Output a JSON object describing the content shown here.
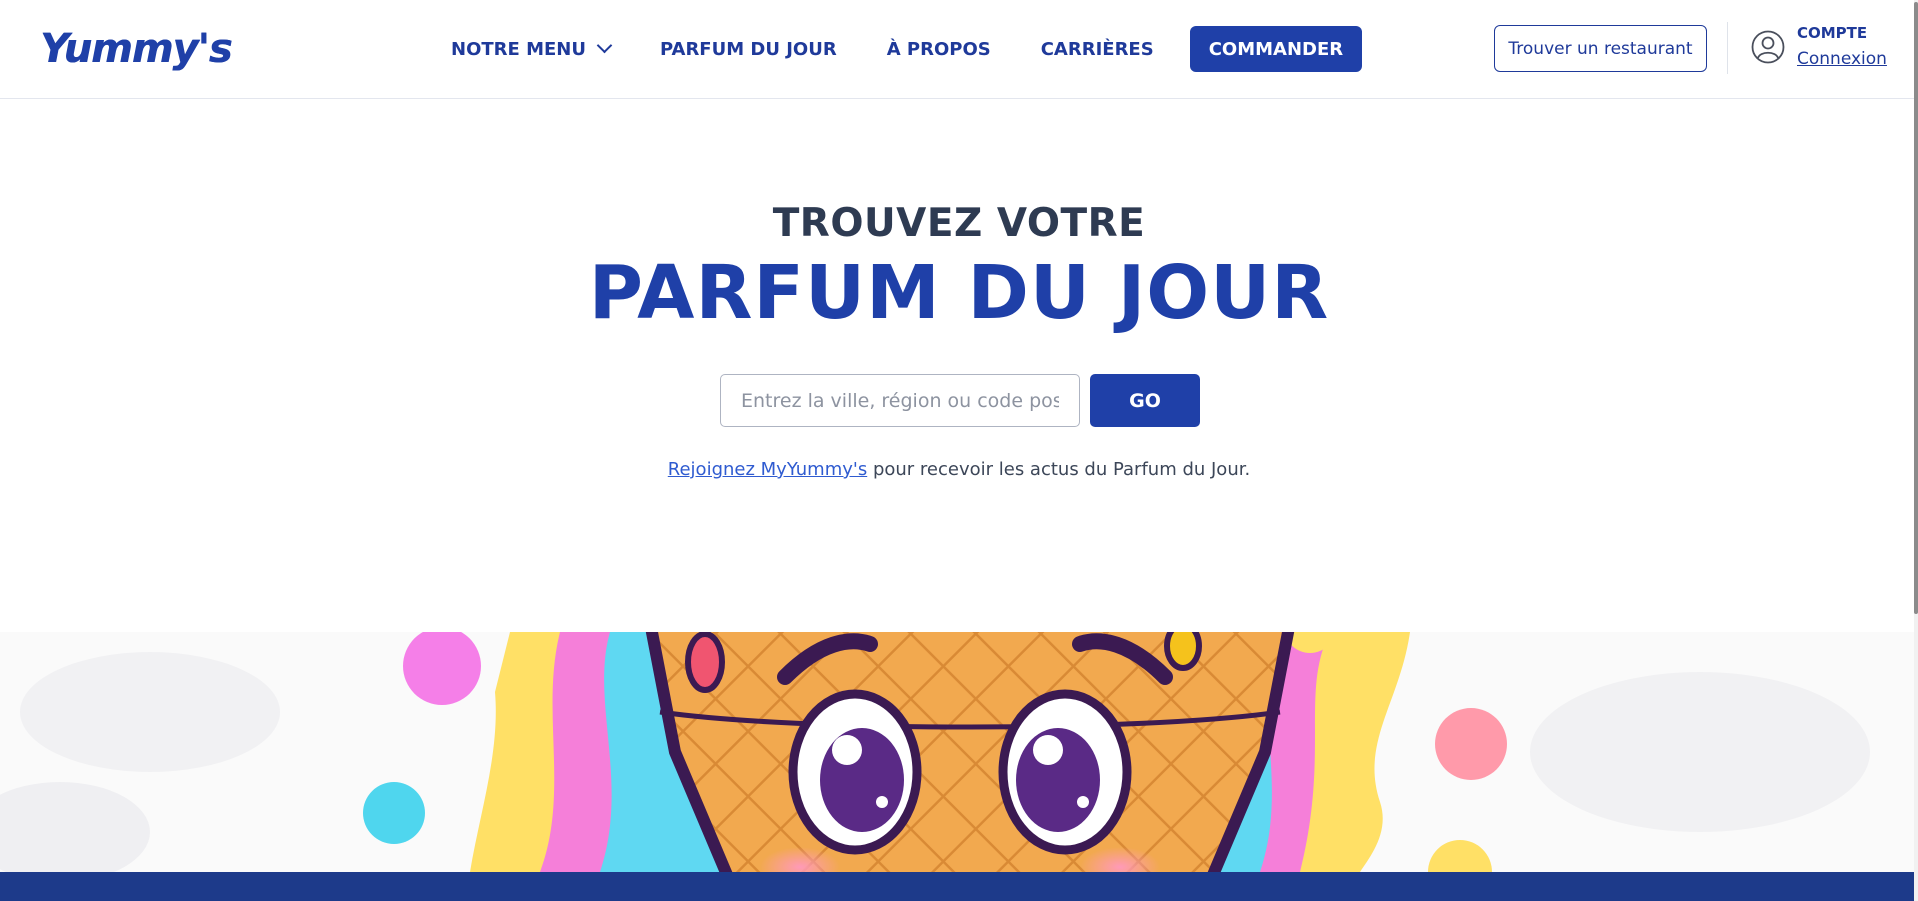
{
  "header": {
    "logo": "Yummy's",
    "nav": {
      "menu": "NOTRE MENU",
      "flavor": "PARFUM DU JOUR",
      "about": "À PROPOS",
      "careers": "CARRIÈRES"
    },
    "order_button": "COMMANDER",
    "find_restaurant": "Trouver un restaurant",
    "account_label": "COMPTE",
    "login": "Connexion"
  },
  "hero": {
    "kicker": "TROUVEZ VOTRE",
    "title": "PARFUM DU JOUR",
    "search_placeholder": "Entrez la ville, région ou code postal",
    "search_value": "",
    "go_button": "GO",
    "join_link": "Rejoignez MyYummy's",
    "join_text": " pour recevoir les actus du Parfum du Jour."
  },
  "colors": {
    "brand_blue": "#1f40a8",
    "footer_blue": "#1d3a8a"
  },
  "icons": {
    "menu_chevron": "chevron-down-icon",
    "account": "user-circle-icon"
  }
}
